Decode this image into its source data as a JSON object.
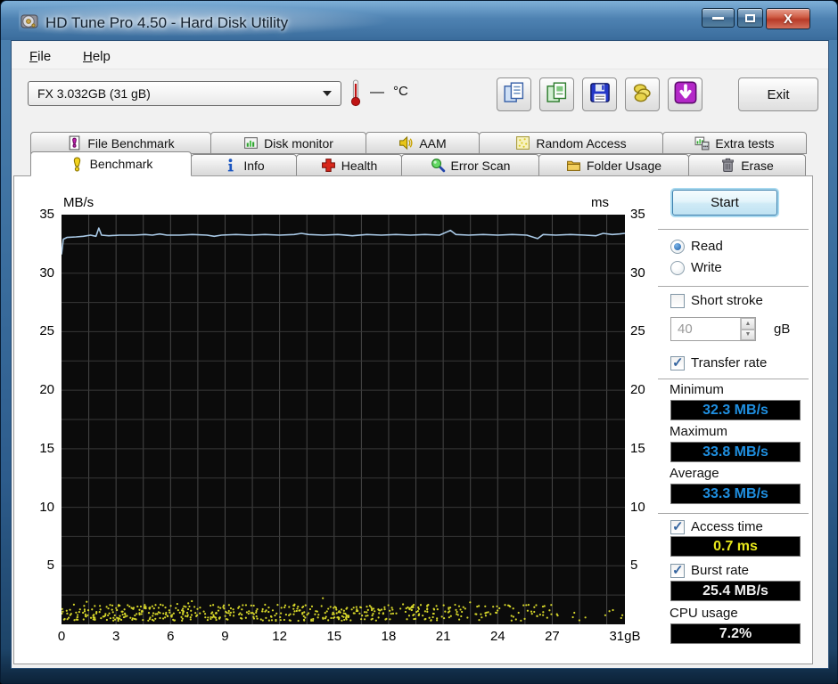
{
  "window": {
    "title": "HD Tune Pro 4.50 - Hard Disk Utility",
    "icon": "hard-disk-icon",
    "caption_buttons": [
      "minimize",
      "maximize",
      "close"
    ]
  },
  "menu": {
    "items": [
      {
        "label": "File"
      },
      {
        "label": "Help"
      }
    ]
  },
  "toolbar": {
    "device_selector": {
      "value": "FX 3.032GB (31 gB)"
    },
    "temperature": {
      "icon": "thermometer-icon",
      "value": "—",
      "unit": "°C"
    },
    "buttons": [
      {
        "name": "copy-info-button",
        "icon": "copy-info-icon"
      },
      {
        "name": "copy-screenshot-button",
        "icon": "copy-screenshot-icon"
      },
      {
        "name": "save-screenshot-button",
        "icon": "save-icon"
      },
      {
        "name": "options-button",
        "icon": "coins-icon"
      },
      {
        "name": "check-updates-button",
        "icon": "download-icon"
      }
    ],
    "exit_label": "Exit"
  },
  "tabs": {
    "row1": [
      {
        "label": "File Benchmark",
        "icon": "file-benchmark-icon"
      },
      {
        "label": "Disk monitor",
        "icon": "disk-monitor-icon"
      },
      {
        "label": "AAM",
        "icon": "speaker-icon"
      },
      {
        "label": "Random Access",
        "icon": "random-access-icon"
      },
      {
        "label": "Extra tests",
        "icon": "extra-tests-icon"
      }
    ],
    "row2": [
      {
        "label": "Benchmark",
        "icon": "exclamation-icon",
        "active": true
      },
      {
        "label": "Info",
        "icon": "info-icon"
      },
      {
        "label": "Health",
        "icon": "health-cross-icon"
      },
      {
        "label": "Error Scan",
        "icon": "magnifier-icon"
      },
      {
        "label": "Folder Usage",
        "icon": "folder-icon"
      },
      {
        "label": "Erase",
        "icon": "trash-icon"
      }
    ],
    "active": "Benchmark"
  },
  "benchmark_panel": {
    "start_label": "Start",
    "read_label": "Read",
    "write_label": "Write",
    "read_selected": true,
    "short_stroke_label": "Short stroke",
    "short_stroke_checked": false,
    "short_stroke_value": "40",
    "short_stroke_unit": "gB",
    "transfer_rate_label": "Transfer rate",
    "transfer_rate_checked": true,
    "minimum_label": "Minimum",
    "minimum_value": "32.3 MB/s",
    "maximum_label": "Maximum",
    "maximum_value": "33.8 MB/s",
    "average_label": "Average",
    "average_value": "33.3 MB/s",
    "access_time_label": "Access time",
    "access_time_checked": true,
    "access_time_value": "0.7 ms",
    "burst_rate_label": "Burst rate",
    "burst_rate_checked": true,
    "burst_rate_value": "25.4 MB/s",
    "cpu_usage_label": "CPU usage",
    "cpu_usage_value": "7.2%"
  },
  "chart_data": {
    "type": "line",
    "title": "",
    "left_axis": {
      "label": "MB/s",
      "range": [
        0,
        35
      ],
      "ticks": [
        35,
        30,
        25,
        20,
        15,
        10,
        5
      ]
    },
    "right_axis": {
      "label": "ms",
      "range": [
        0,
        35
      ],
      "ticks": [
        35,
        30,
        25,
        20,
        15,
        10,
        5
      ]
    },
    "x_axis": {
      "range": [
        0,
        31
      ],
      "tick_values": [
        0,
        3,
        6,
        9,
        12,
        15,
        18,
        21,
        24,
        27,
        31
      ],
      "tick_labels": [
        "0",
        "3",
        "6",
        "9",
        "12",
        "15",
        "18",
        "21",
        "24",
        "27",
        "31gB"
      ]
    },
    "grid": {
      "h_step": 2.5,
      "v_step": 1.5,
      "h_color": "#383838",
      "v_color": "#474747",
      "bg": "#0b0b0b"
    },
    "series": [
      {
        "name": "Transfer rate",
        "unit": "MB/s",
        "color": "#a9c9e6",
        "type": "line",
        "points": [
          [
            0,
            31.6
          ],
          [
            0.1,
            32.9
          ],
          [
            0.3,
            33.05
          ],
          [
            0.8,
            33.1
          ],
          [
            1.2,
            33.15
          ],
          [
            1.6,
            33.25
          ],
          [
            1.9,
            33.15
          ],
          [
            2.05,
            33.85
          ],
          [
            2.2,
            33.25
          ],
          [
            2.6,
            33.2
          ],
          [
            3.2,
            33.25
          ],
          [
            4,
            33.25
          ],
          [
            4.6,
            33.3
          ],
          [
            5,
            33.25
          ],
          [
            5.4,
            33.35
          ],
          [
            5.8,
            33.25
          ],
          [
            6.5,
            33.25
          ],
          [
            7.2,
            33.3
          ],
          [
            8,
            33.25
          ],
          [
            8.4,
            33.15
          ],
          [
            8.8,
            33.25
          ],
          [
            9.6,
            33.3
          ],
          [
            10.4,
            33.25
          ],
          [
            11.2,
            33.3
          ],
          [
            12,
            33.25
          ],
          [
            12.8,
            33.3
          ],
          [
            13.2,
            33.4
          ],
          [
            13.6,
            33.3
          ],
          [
            14.4,
            33.25
          ],
          [
            15.2,
            33.3
          ],
          [
            16,
            33.2
          ],
          [
            16.8,
            33.3
          ],
          [
            17.6,
            33.25
          ],
          [
            18.4,
            33.3
          ],
          [
            19.2,
            33.25
          ],
          [
            20,
            33.3
          ],
          [
            20.8,
            33.25
          ],
          [
            21.4,
            33.65
          ],
          [
            21.7,
            33.3
          ],
          [
            22.4,
            33.25
          ],
          [
            23.2,
            33.3
          ],
          [
            24,
            33.25
          ],
          [
            24.8,
            33.3
          ],
          [
            25.6,
            33.25
          ],
          [
            26.2,
            32.95
          ],
          [
            26.5,
            33.3
          ],
          [
            27.2,
            33.25
          ],
          [
            28,
            33.3
          ],
          [
            28.8,
            33.25
          ],
          [
            29.4,
            33.2
          ],
          [
            29.8,
            33.4
          ],
          [
            30.3,
            33.3
          ],
          [
            30.7,
            33.35
          ],
          [
            31,
            33.4
          ]
        ]
      },
      {
        "name": "Access time",
        "unit": "ms",
        "color": "#d6d62a",
        "type": "scatter",
        "typical_value_ms": 0.7,
        "seed": 1337,
        "count": 680,
        "y_band_ms": [
          0.3,
          1.7
        ],
        "spike_chance": 0.06,
        "spike_extra_ms": 1.0,
        "fade_start_gb": 20,
        "min_keep": 0.15
      }
    ],
    "stats": {
      "minimum": "32.3 MB/s",
      "maximum": "33.8 MB/s",
      "average": "33.3 MB/s",
      "access_time": "0.7 ms",
      "burst_rate": "25.4 MB/s",
      "cpu_usage": "7.2%"
    }
  }
}
